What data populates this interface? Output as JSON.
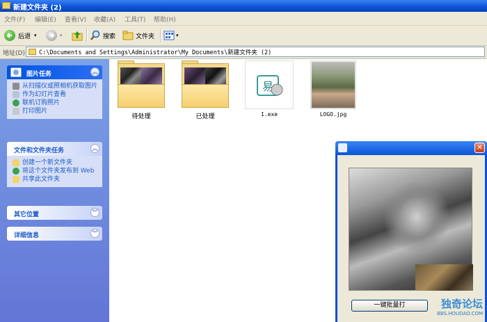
{
  "window": {
    "title": "新建文件夹 (2)"
  },
  "menu": [
    "文件(F)",
    "编辑(E)",
    "查看(V)",
    "收藏(A)",
    "工具(T)",
    "帮助(H)"
  ],
  "toolbar": {
    "back": "后退",
    "search": "搜索",
    "folders": "文件夹"
  },
  "address": {
    "label": "地址(D)",
    "path": "C:\\Documents and Settings\\Administrator\\My Documents\\新建文件夹 (2)"
  },
  "tasks": {
    "picture": {
      "title": "图片任务",
      "items": [
        "从扫描仪或照相机获取图片",
        "作为幻灯片查看",
        "联机订购照片",
        "打印图片"
      ]
    },
    "file": {
      "title": "文件和文件夹任务",
      "items": [
        "创建一个新文件夹",
        "将这个文件夹发布到 Web",
        "共享此文件夹"
      ]
    },
    "other": {
      "title": "其它位置"
    },
    "details": {
      "title": "详细信息"
    }
  },
  "files": [
    {
      "name": "待处理",
      "type": "folder"
    },
    {
      "name": "已处理",
      "type": "folder"
    },
    {
      "name": "1.exe",
      "type": "exe"
    },
    {
      "name": "LOGO.jpg",
      "type": "image"
    }
  ],
  "dialog": {
    "button": "一键批量打",
    "watermark": "独奇论坛",
    "watermark_url": "BBS.HOUDAO.COM"
  }
}
